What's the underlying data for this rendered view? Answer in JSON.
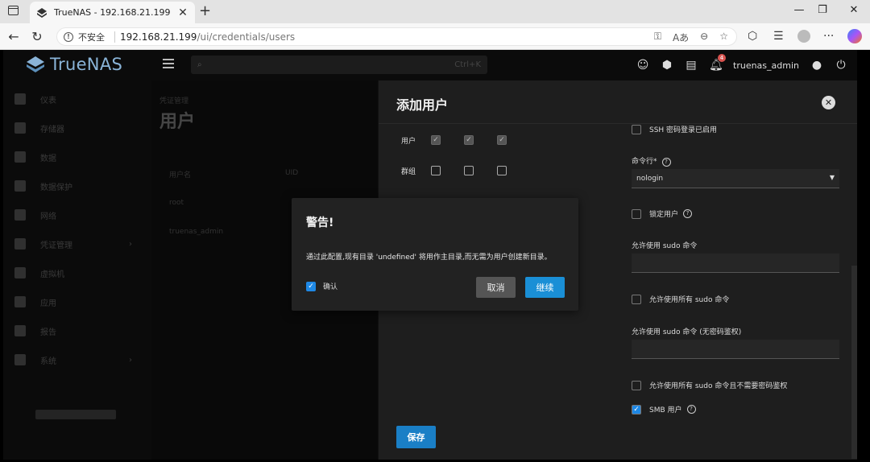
{
  "browser": {
    "tab_title": "TrueNAS - 192.168.21.199",
    "insecure_label": "不安全",
    "url_host": "192.168.21.199",
    "url_path": "/ui/credentials/users"
  },
  "app": {
    "brand": "TrueNAS",
    "username": "truenas_admin",
    "notification_count": "4"
  },
  "sidebar": {
    "items": [
      {
        "label": "仪表"
      },
      {
        "label": "存储器"
      },
      {
        "label": "数据"
      },
      {
        "label": "数据保护"
      },
      {
        "label": "网络"
      },
      {
        "label": "凭证管理"
      },
      {
        "label": "虚拟机"
      },
      {
        "label": "应用"
      },
      {
        "label": "报告"
      },
      {
        "label": "系统"
      }
    ]
  },
  "main": {
    "breadcrumb": "凭证管理",
    "title": "用户",
    "col_username": "用户名",
    "col_uid": "UID",
    "rows": [
      "root",
      "truenas_admin"
    ]
  },
  "panel": {
    "title": "添加用户",
    "perm_user_label": "用户",
    "perm_group_label": "群组",
    "ssh_label": "SSH 密码登录已启用",
    "shell_label": "命令行*",
    "shell_value": "nologin",
    "lock_user_label": "锁定用户",
    "sudo_allowed_label": "允许使用 sudo 命令",
    "sudo_all_label": "允许使用所有 sudo 命令",
    "sudo_nopass_label": "允许使用 sudo 命令 (无密码鉴权)",
    "sudo_all_nopass_label": "允许使用所有 sudo 命令且不需要密码鉴权",
    "smb_label": "SMB 用户",
    "save_label": "保存"
  },
  "dialog": {
    "title": "警告!",
    "message": "通过此配置,现有目录 'undefined' 将用作主目录,而无需为用户创建新目录。",
    "confirm_label": "确认",
    "cancel_label": "取消",
    "continue_label": "继续"
  },
  "colors": {
    "accent": "#1a8fd6",
    "panel_bg": "#1e1e1e",
    "dialog_bg": "#222222"
  }
}
